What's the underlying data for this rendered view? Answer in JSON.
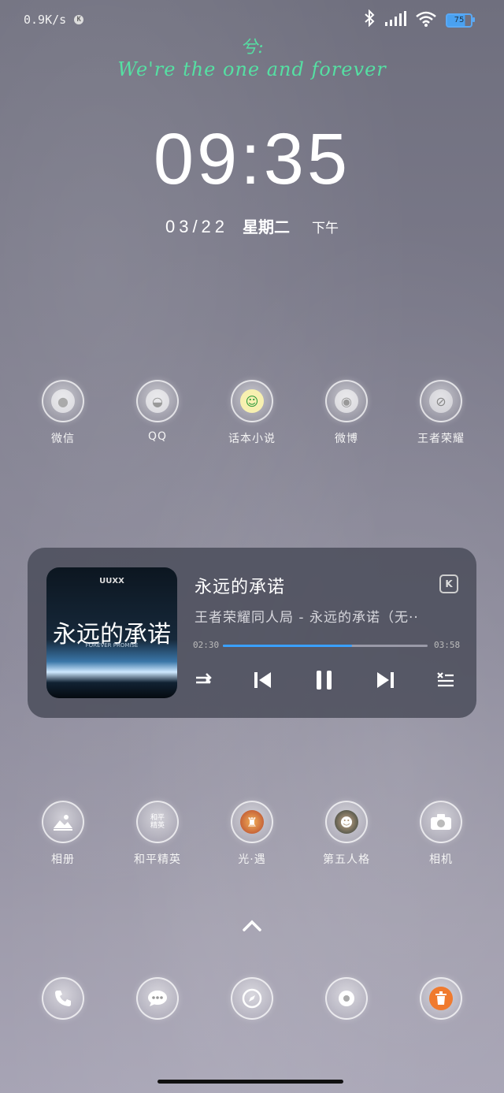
{
  "status": {
    "net_speed": "0.9K/s",
    "battery": "75",
    "icons": [
      "k-icon",
      "bluetooth-icon",
      "signal-icon",
      "wifi-icon",
      "battery-icon"
    ]
  },
  "quote": {
    "line1": "兮:",
    "line2": "We're the one and forever"
  },
  "clock": {
    "time": "09:35",
    "date": "03/22",
    "weekday": "星期二",
    "period": "下午"
  },
  "apps_row1": [
    {
      "label": "微信",
      "icon": "wechat-icon"
    },
    {
      "label": "QQ",
      "icon": "qq-icon"
    },
    {
      "label": "话本小说",
      "icon": "huaben-icon"
    },
    {
      "label": "微博",
      "icon": "weibo-icon"
    },
    {
      "label": "王者荣耀",
      "icon": "honor-of-kings-icon"
    }
  ],
  "music": {
    "title": "永远的承诺",
    "artist": "王者荣耀同人局 - 永远的承诺（无··",
    "current": "02:30",
    "total": "03:58",
    "progress": 0.63,
    "cover": {
      "tag": "UUXX",
      "title": "永远的承诺",
      "sub": "FOREVER PROMISE"
    },
    "accent": "#3aa0ff"
  },
  "apps_row2": [
    {
      "label": "相册",
      "icon": "gallery-icon"
    },
    {
      "label": "和平精英",
      "icon": "peace-elite-icon",
      "inner": "和平\n精英"
    },
    {
      "label": "光·遇",
      "icon": "sky-icon"
    },
    {
      "label": "第五人格",
      "icon": "identity-v-icon"
    },
    {
      "label": "相机",
      "icon": "camera-icon"
    }
  ],
  "dock": [
    "phone-icon",
    "messages-icon",
    "browser-icon",
    "settings-icon",
    "cleaner-icon"
  ]
}
